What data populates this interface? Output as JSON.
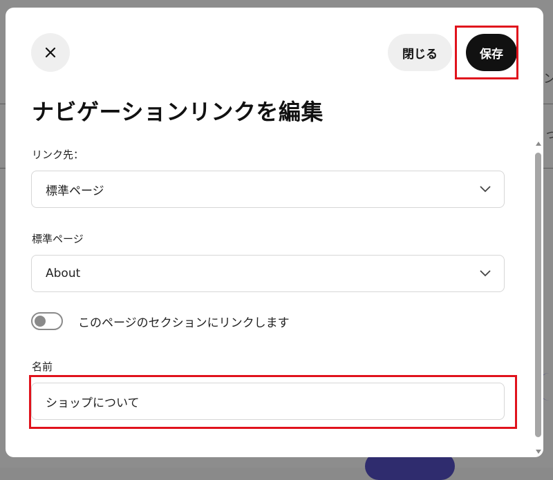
{
  "modal": {
    "title": "ナビゲーションリンクを編集",
    "close_icon": "close-icon",
    "close_button_label": "閉じる",
    "save_button_label": "保存"
  },
  "form": {
    "link_target": {
      "label": "リンク先：",
      "selected": "標準ページ"
    },
    "standard_page": {
      "label": "標準ページ",
      "selected": "About"
    },
    "section_toggle": {
      "label": "このページのセクションにリンクします",
      "on": false
    },
    "name": {
      "label": "名前",
      "value": "ショップについて"
    }
  },
  "colors": {
    "primary_button": "#111111",
    "highlight": "#e0121c",
    "overlay": "#8d8d8d"
  }
}
